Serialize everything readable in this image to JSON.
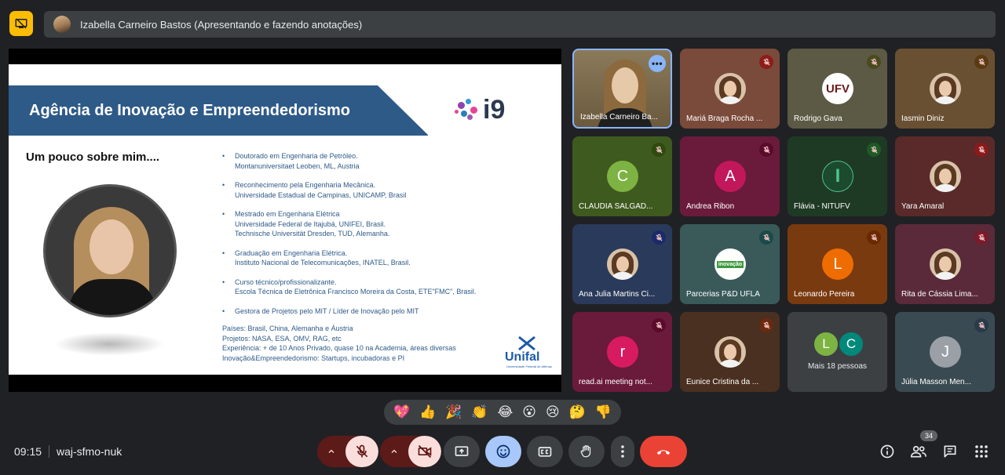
{
  "presenter_bar": {
    "text": "Izabella Carneiro Bastos (Apresentando e fazendo anotações)"
  },
  "slide": {
    "title": "Agência de Inovação e Empreendedorismo",
    "logo_text": "i9",
    "subtitle": "Um pouco sobre mim....",
    "bullets": [
      {
        "lines": [
          "Doutorado em Engenharia de Petróleo.",
          "Montanuniversitaet Leoben, ML, Austria"
        ]
      },
      {
        "lines": [
          "Reconhecimento pela Engenharia Mecânica.",
          "Universidade Estadual de Campinas, UNICAMP, Brasil"
        ]
      },
      {
        "lines": [
          "Mestrado em Engenharia Elétrica",
          "Universidade Federal de Itajubá, UNIFEI, Brasil.",
          "Technische Universität Dresden, TUD, Alemanha."
        ]
      },
      {
        "lines": [
          "Graduação em Engenharia Elétrica.",
          "Instituto Nacional de Telecomunicações, INATEL, Brasil."
        ]
      },
      {
        "lines": [
          "Curso técnico/profissionalizante.",
          "Escola Técnica de Eletrônica Francisco Moreira da Costa, ETE\"FMC\", Brasil."
        ]
      },
      {
        "lines": [
          "Gestora de Projetos pelo MIT / Líder de Inovação pelo MIT"
        ]
      }
    ],
    "footer": [
      "Países: Brasil, China, Alemanha e Áustria",
      "Projetos: NASA, ESA, OMV, RAG, etc",
      "Experiência: + de 10 Anos Privado, quase 10 na Academia, áreas diversas",
      "Inovação&Empreendedorismo: Startups, incubadoras e PI"
    ],
    "unifal_text": "Unifal",
    "unifal_sub": "Universidade Federal de Alfenas"
  },
  "participants": [
    {
      "name": "Izabella Carneiro Ba...",
      "kind": "video",
      "bg": "#7a6a4c"
    },
    {
      "name": "Mariá Braga Rocha ...",
      "kind": "photo",
      "bg": "#7a4a3a",
      "mic_color": "#8b1e1a"
    },
    {
      "name": "Rodrigo Gava",
      "kind": "logo",
      "logo": "UFV",
      "bg": "#5c5a44",
      "mic_color": "#4a4a1e"
    },
    {
      "name": "Iasmin Diniz",
      "kind": "photo",
      "bg": "#6a5032",
      "mic_color": "#5a3a10"
    },
    {
      "name": "CLAUDIA SALGAD...",
      "kind": "letter",
      "letter": "C",
      "avatar_color": "#7cb342",
      "bg": "#3e5a1e",
      "mic_color": "#2e4a10"
    },
    {
      "name": "Andrea Ribon",
      "kind": "letter",
      "letter": "A",
      "avatar_color": "#c2185b",
      "bg": "#6a1a3a",
      "mic_color": "#5a0a2a"
    },
    {
      "name": "Flávia - NITUFV",
      "kind": "logo",
      "logo": "I",
      "bg": "#1e3a24",
      "mic_color": "#1e5a24"
    },
    {
      "name": "Yara Amaral",
      "kind": "photo",
      "bg": "#5a2a2a",
      "mic_color": "#8b1a1a"
    },
    {
      "name": "Ana Julia Martins Ci...",
      "kind": "photo",
      "bg": "#2a3a5a",
      "mic_color": "#1a2a6a"
    },
    {
      "name": "Parcerias P&D UFLA",
      "kind": "logo",
      "logo": "inovação",
      "bg": "#3a5a5a",
      "mic_color": "#1a4a4a"
    },
    {
      "name": "Leonardo Pereira",
      "kind": "letter",
      "letter": "L",
      "avatar_color": "#ef6c00",
      "bg": "#7a3a10",
      "mic_color": "#6a2a00"
    },
    {
      "name": "Rita de Cássia Lima...",
      "kind": "photo",
      "bg": "#5a2a3a",
      "mic_color": "#7a1a2a"
    },
    {
      "name": "read.ai meeting not...",
      "kind": "letter",
      "letter": "r",
      "avatar_color": "#d81b60",
      "bg": "#6a1a3a",
      "mic_color": "#5a0a2a"
    },
    {
      "name": "Eunice Cristina da ...",
      "kind": "photo",
      "bg": "#4a3020",
      "mic_color": "#6a2a10"
    },
    {
      "name": "Mais 18 pessoas",
      "kind": "more",
      "letters": [
        "L",
        "C"
      ],
      "bg": "#3c4043"
    },
    {
      "name": "Júlia Masson Men...",
      "kind": "letter",
      "letter": "J",
      "avatar_color": "#9aa0a6",
      "bg": "#3a4a52",
      "mic_color": "#2a3a4a"
    }
  ],
  "reactions": [
    "💖",
    "👍",
    "🎉",
    "👏",
    "😂",
    "😮",
    "😢",
    "🤔",
    "👎"
  ],
  "bottom_bar": {
    "time": "09:15",
    "meeting_code": "waj-sfmo-nuk",
    "people_count": "34"
  }
}
